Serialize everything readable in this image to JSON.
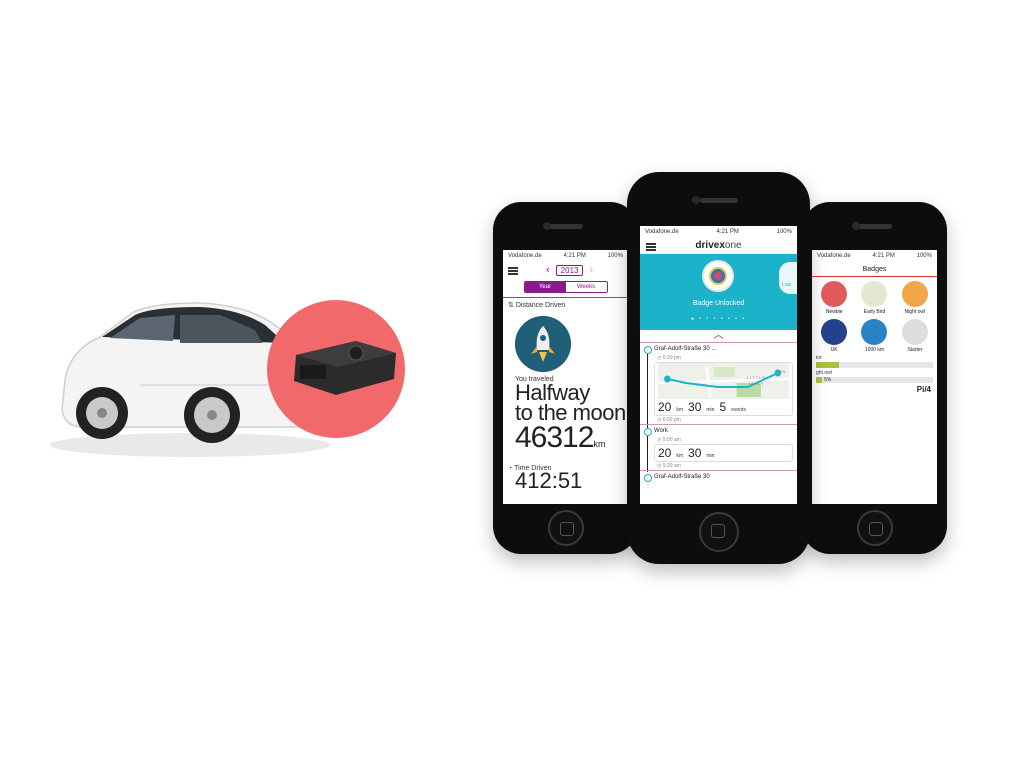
{
  "hero": {
    "product": "OBD dongle plugged into white sedan",
    "accent_color": "#f2696b"
  },
  "status_bar": {
    "carrier": "Vodafone.de",
    "time": "4:21 PM",
    "battery": "100%"
  },
  "phone_left": {
    "year": "2013",
    "tabs": [
      "Year",
      "Weeks"
    ],
    "active_tab": "Year",
    "distance_label": "Distance Driven",
    "you_traveled": "You traveled",
    "headline_line1": "Halfway",
    "headline_line2": "to the moon",
    "distance_value": "46312",
    "distance_unit": "km",
    "time_label": "Time Driven",
    "time_value": "412:51"
  },
  "phone_center": {
    "logo_bold": "drivex",
    "logo_light": "one",
    "badge_message": "Badge Unlocked",
    "next_badge_hint": "Low",
    "trips": [
      {
        "title": "Graf-Adolf-Straße 30 ...",
        "start_time": "6:30 pm",
        "end_time": "6:00 pm",
        "distance": "20",
        "distance_unit": "km",
        "duration": "30",
        "duration_unit": "min",
        "events": "5",
        "events_unit": "events",
        "map_labels": [
          "LITTLE",
          "ITALY",
          "KEN"
        ]
      },
      {
        "title": "Work",
        "start_time": "9:00 am",
        "end_time": "9:30 am",
        "distance": "20",
        "distance_unit": "km",
        "duration": "30",
        "duration_unit": "min"
      }
    ],
    "next_trip": "Graf-Adolf-Straße 30"
  },
  "phone_right": {
    "title": "Badges",
    "badges": [
      {
        "name": "Newbie",
        "color": "#e15a5a"
      },
      {
        "name": "Early Bird",
        "color": "#e3e8d0"
      },
      {
        "name": "Night owl",
        "color": "#f1a64a"
      },
      {
        "name": "UK",
        "color": "#24418e"
      },
      {
        "name": "1000 km",
        "color": "#2a83c6"
      },
      {
        "name": "Starter",
        "color": "#dddddd"
      }
    ],
    "progress": [
      {
        "label": "ior",
        "percent": 20
      },
      {
        "label": "ght owl",
        "percent": 5,
        "text": "5%"
      }
    ],
    "extra_badge": "Pi/4"
  }
}
